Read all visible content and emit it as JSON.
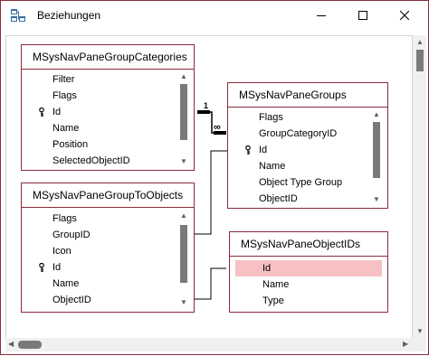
{
  "window": {
    "title": "Beziehungen"
  },
  "tables": [
    {
      "id": "t1",
      "title": "MSysNavPaneGroupCategories",
      "fields": [
        {
          "name": "Filter",
          "key": false,
          "selected": false
        },
        {
          "name": "Flags",
          "key": false,
          "selected": false
        },
        {
          "name": "Id",
          "key": true,
          "selected": false
        },
        {
          "name": "Name",
          "key": false,
          "selected": false
        },
        {
          "name": "Position",
          "key": false,
          "selected": false
        },
        {
          "name": "SelectedObjectID",
          "key": false,
          "selected": false
        }
      ]
    },
    {
      "id": "t2",
      "title": "MSysNavPaneGroups",
      "fields": [
        {
          "name": "Flags",
          "key": false,
          "selected": false
        },
        {
          "name": "GroupCategoryID",
          "key": false,
          "selected": false
        },
        {
          "name": "Id",
          "key": true,
          "selected": false
        },
        {
          "name": "Name",
          "key": false,
          "selected": false
        },
        {
          "name": "Object Type Group",
          "key": false,
          "selected": false
        },
        {
          "name": "ObjectID",
          "key": false,
          "selected": false
        }
      ]
    },
    {
      "id": "t3",
      "title": "MSysNavPaneGroupToObjects",
      "fields": [
        {
          "name": "Flags",
          "key": false,
          "selected": false
        },
        {
          "name": "GroupID",
          "key": false,
          "selected": false
        },
        {
          "name": "Icon",
          "key": false,
          "selected": false
        },
        {
          "name": "Id",
          "key": true,
          "selected": false
        },
        {
          "name": "Name",
          "key": false,
          "selected": false
        },
        {
          "name": "ObjectID",
          "key": false,
          "selected": false
        }
      ]
    },
    {
      "id": "t4",
      "title": "MSysNavPaneObjectIDs",
      "fields": [
        {
          "name": "Id",
          "key": true,
          "selected": true
        },
        {
          "name": "Name",
          "key": false,
          "selected": false
        },
        {
          "name": "Type",
          "key": false,
          "selected": false
        }
      ]
    }
  ],
  "relationships": [
    {
      "from": "t1",
      "to": "t2",
      "one_label": "1",
      "many_label": "∞"
    }
  ],
  "colors": {
    "border": "#8a2b3a",
    "selected_row": "#f7c0c3",
    "scroll_thumb": "#7a7a7a"
  },
  "icons": {
    "app": "relationships-icon",
    "minimize": "minimize-icon",
    "maximize": "maximize-icon",
    "close": "close-icon",
    "key": "key-icon"
  }
}
